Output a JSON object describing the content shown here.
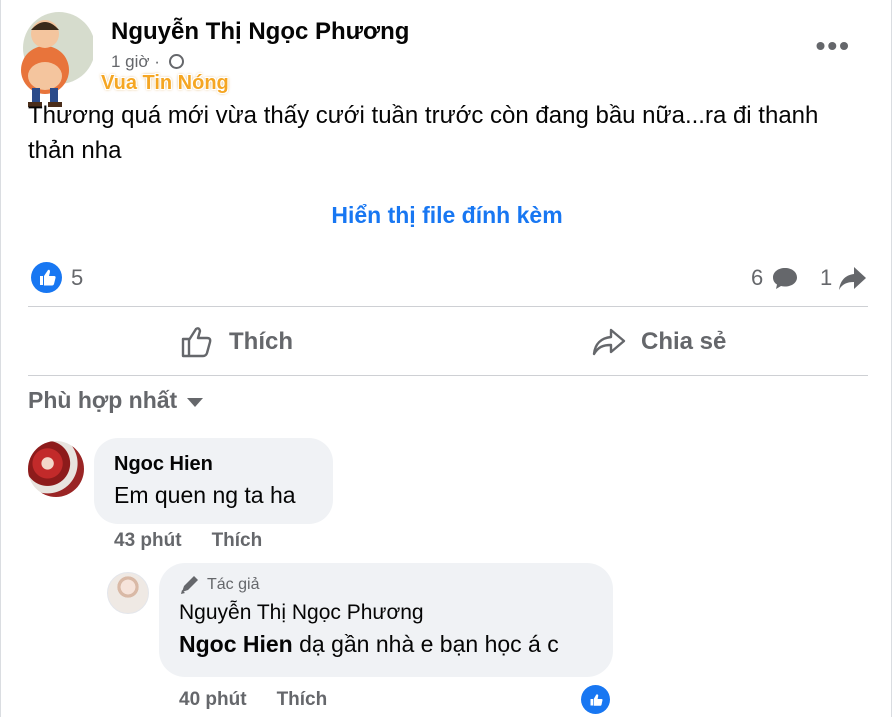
{
  "post": {
    "author": "Nguyễn Thị Ngọc Phương",
    "time": "1 giờ ·",
    "watermark": "Vua Tin Nóng",
    "more_label": "•••",
    "text": "Thương quá mới vừa thấy cưới tuần trước còn đang bầu nữa...ra đi thanh thản nha",
    "attachment_link": "Hiển thị file đính kèm"
  },
  "reactions": {
    "likes": "5",
    "comments": "6",
    "shares": "1"
  },
  "actions": {
    "like_label": "Thích",
    "share_label": "Chia sẻ"
  },
  "comments_sort": "Phù hợp nhất",
  "comments": [
    {
      "name": "Ngoc Hien",
      "text": "Em quen ng ta ha",
      "time": "43 phút",
      "like_label": "Thích"
    }
  ],
  "reply": {
    "badge": "Tác giả",
    "name": "Nguyễn Thị Ngọc Phương",
    "mention": "Ngoc Hien",
    "text": " dạ gần nhà e bạn học á c",
    "time": "40 phút",
    "like_label": "Thích"
  },
  "colors": {
    "accent": "#1877f2",
    "secondary_text": "#65676b",
    "bubble": "#f0f2f5",
    "watermark": "#f5a623"
  }
}
